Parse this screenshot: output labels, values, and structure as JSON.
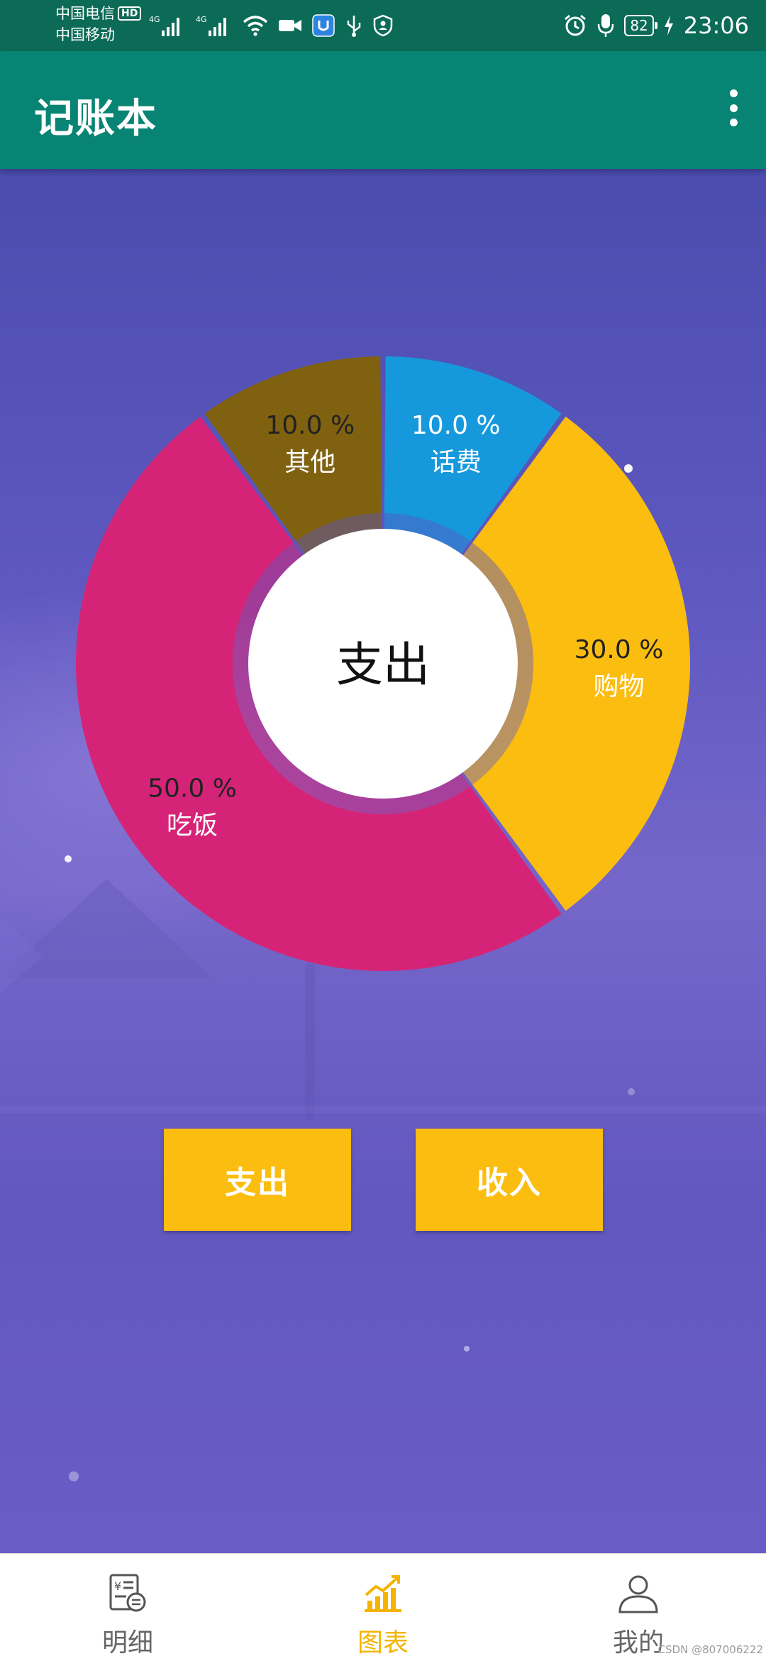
{
  "status_bar": {
    "carrier_1": "中国电信",
    "carrier_1_badge": "HD",
    "carrier_2": "中国移动",
    "signal_label_1": "4G",
    "signal_label_2": "4G",
    "battery": "82",
    "time": "23:06"
  },
  "app_bar": {
    "title": "记账本",
    "menu_icon": "more-vert-icon"
  },
  "chart_data": {
    "type": "pie",
    "center_label": "支出",
    "slices": [
      {
        "name": "话费",
        "value": 10.0,
        "label": "10.0 %",
        "color": "#1699dc",
        "label_color": "#ffffff",
        "value_color": "#ffffff"
      },
      {
        "name": "购物",
        "value": 30.0,
        "label": "30.0 %",
        "color": "#fbbd10",
        "label_color": "#ffffff",
        "value_color": "#222222"
      },
      {
        "name": "吃饭",
        "value": 50.0,
        "label": "50.0 %",
        "color": "#d52477",
        "label_color": "#ffffff",
        "value_color": "#222222"
      },
      {
        "name": "其他",
        "value": 10.0,
        "label": "10.0 %",
        "color": "#806110",
        "label_color": "#ffffff",
        "value_color": "#222222"
      }
    ]
  },
  "buttons": {
    "expense": "支出",
    "income": "收入"
  },
  "bottom_nav": {
    "detail": "明细",
    "chart": "图表",
    "mine": "我的",
    "active": "chart"
  },
  "watermark": "CSDN @807006222",
  "colors": {
    "app_bar": "#078473",
    "status_bar": "#0c6b57",
    "accent": "#fbbd10",
    "active_nav": "#f4b400"
  }
}
